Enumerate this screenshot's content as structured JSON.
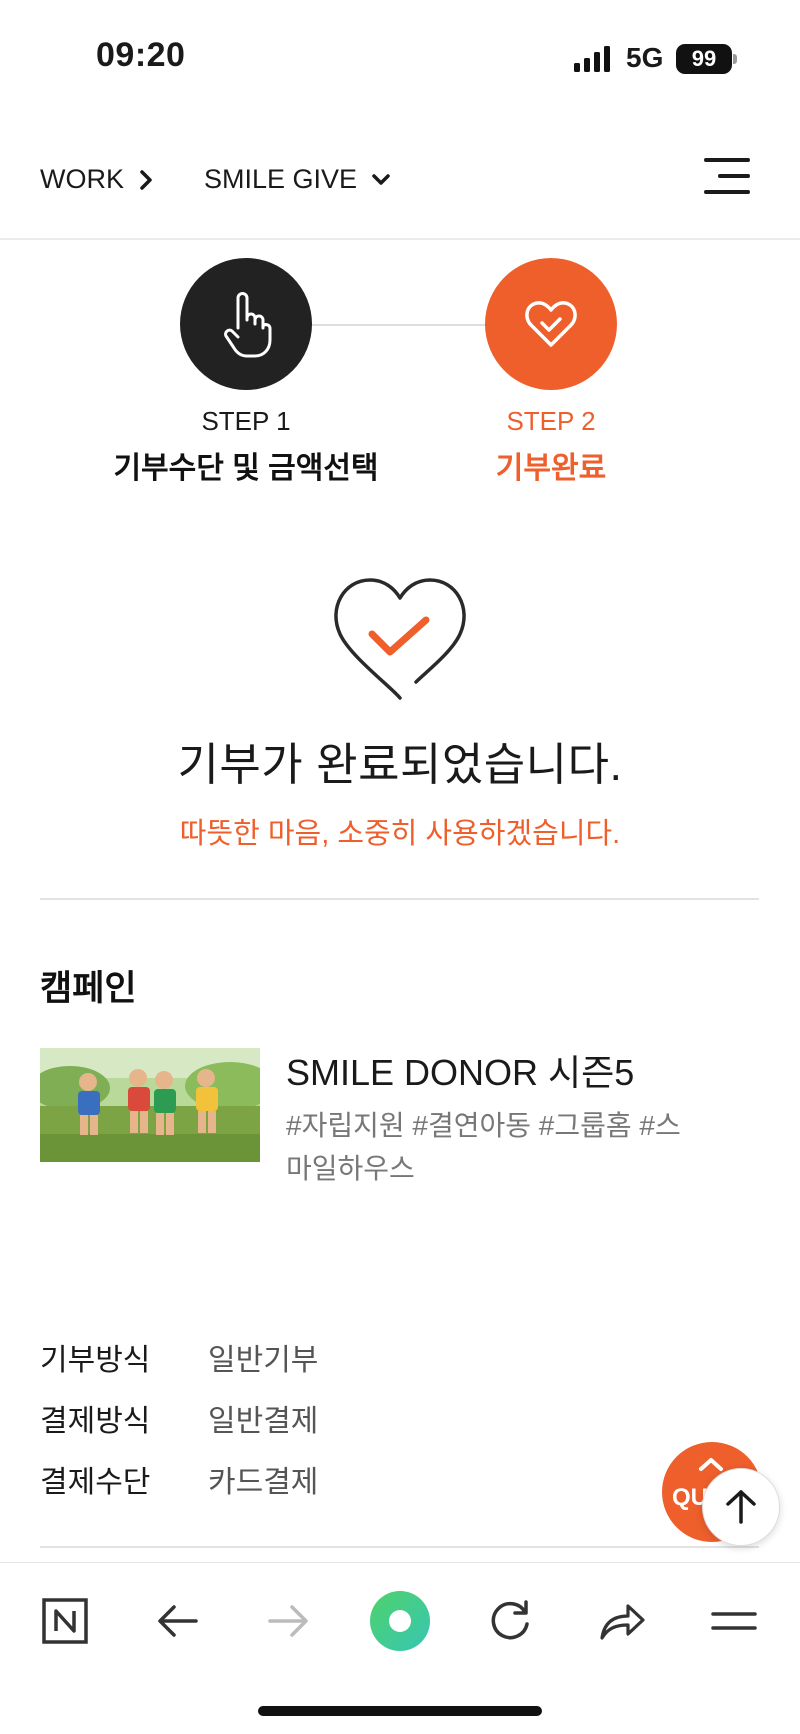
{
  "status_bar": {
    "time": "09:20",
    "network": "5G",
    "battery": "99"
  },
  "header": {
    "breadcrumb_work": "WORK",
    "breadcrumb_current": "SMILE GIVE"
  },
  "steps": [
    {
      "label": "STEP 1",
      "title": "기부수단 및 금액선택",
      "icon": "hand-pointer-icon"
    },
    {
      "label": "STEP 2",
      "title": "기부완료",
      "icon": "heart-check-icon"
    }
  ],
  "completion": {
    "title": "기부가 완료되었습니다.",
    "subtitle": "따뜻한 마음, 소중히 사용하겠습니다."
  },
  "campaign": {
    "section_title": "캠페인",
    "name": "SMILE DONOR 시즌5",
    "tags": "#자립지원 #결연아동 #그룹홈 #스마일하우스",
    "image": "children-running-photo"
  },
  "details": [
    {
      "key": "기부방식",
      "value": "일반기부"
    },
    {
      "key": "결제방식",
      "value": "일반결제"
    },
    {
      "key": "결제수단",
      "value": "카드결제"
    }
  ],
  "floating": {
    "quick_label": "QUI"
  },
  "colors": {
    "accent": "#ee5f2c",
    "dark": "#222222",
    "muted": "#777777"
  },
  "toolbar_icons": [
    "naver-icon",
    "back-arrow-icon",
    "forward-arrow-icon",
    "green-dot-icon",
    "refresh-icon",
    "share-icon",
    "menu-icon"
  ]
}
